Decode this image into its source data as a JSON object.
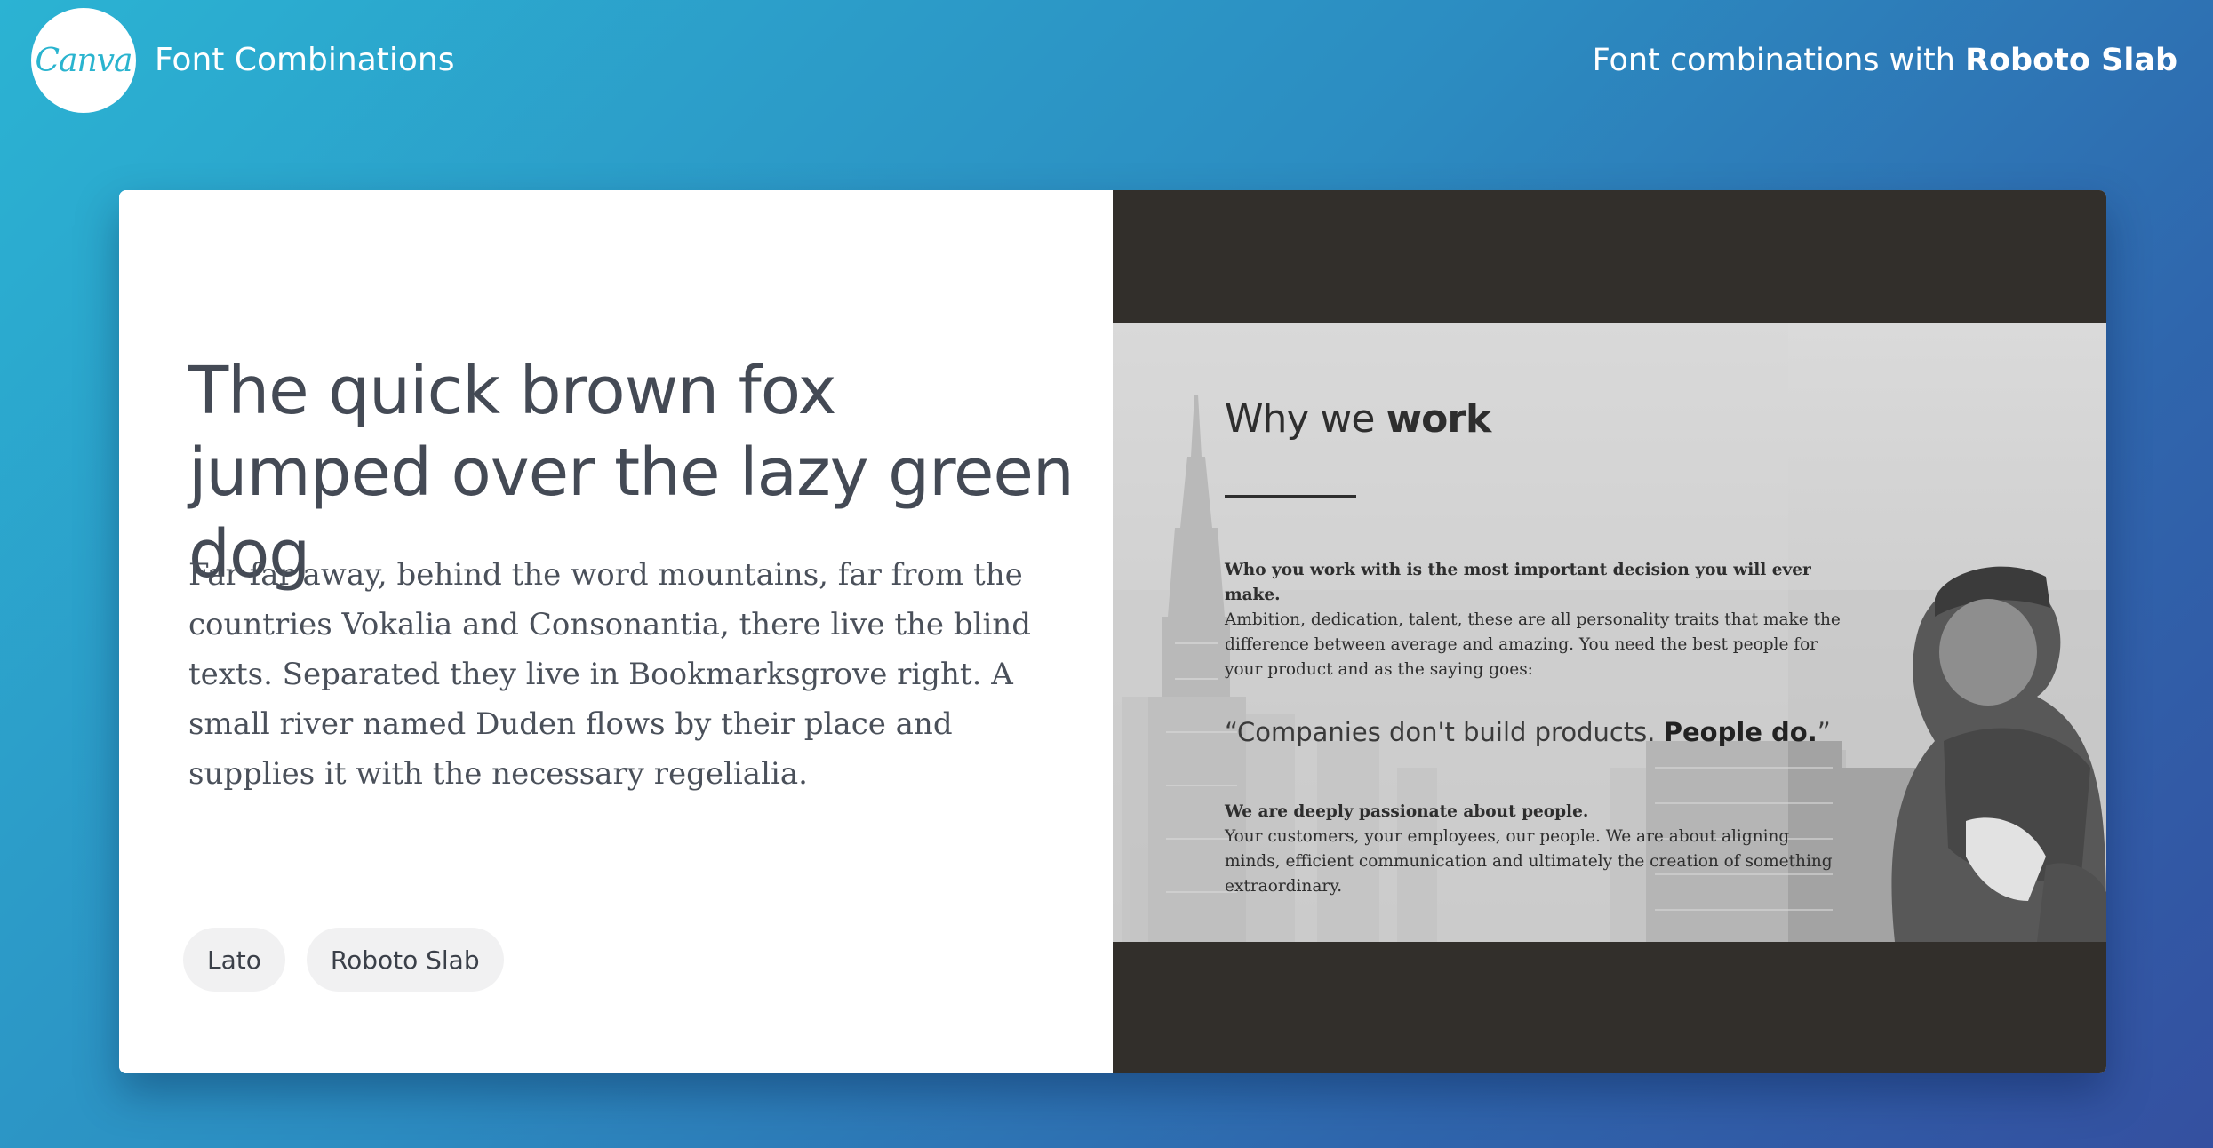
{
  "header": {
    "logo_text": "Canva",
    "brand_title": "Font Combinations",
    "combo_prefix": "Font combinations with",
    "combo_font": "Roboto Slab"
  },
  "sample": {
    "headline": "The quick brown fox jumped over the lazy green dog",
    "body": "Far far away, behind the word mountains, far from the countries Vokalia and Consonantia, there live the blind texts. Separated they live in Bookmarksgrove right. A small river named Duden flows by their place and supplies it with the necessary regelialia.",
    "font_tags": [
      "Lato",
      "Roboto Slab"
    ]
  },
  "preview": {
    "title_light": "Why we",
    "title_bold": "work",
    "para1_lead": "Who you work with is the most important decision you will ever make.",
    "para1_text": "Ambition, dedication, talent, these are all personality traits that make the difference between average and amazing. You need the best people for your product and as the saying goes:",
    "quote_light": "“Companies don't build products.",
    "quote_bold": "People do.",
    "quote_close": "”",
    "para2_lead": "We are deeply passionate about people.",
    "para2_text": "Your customers, your employees, our people. We are about aligning minds, efficient communication and ultimately the creation of something extraordinary."
  },
  "colors": {
    "gradient_start": "#2bb3d3",
    "gradient_end": "#3450a0",
    "logo_text": "#2ab4cf",
    "preview_frame": "#322f2b",
    "text_dark": "#444a55",
    "tag_bg": "#f1f1f2"
  }
}
